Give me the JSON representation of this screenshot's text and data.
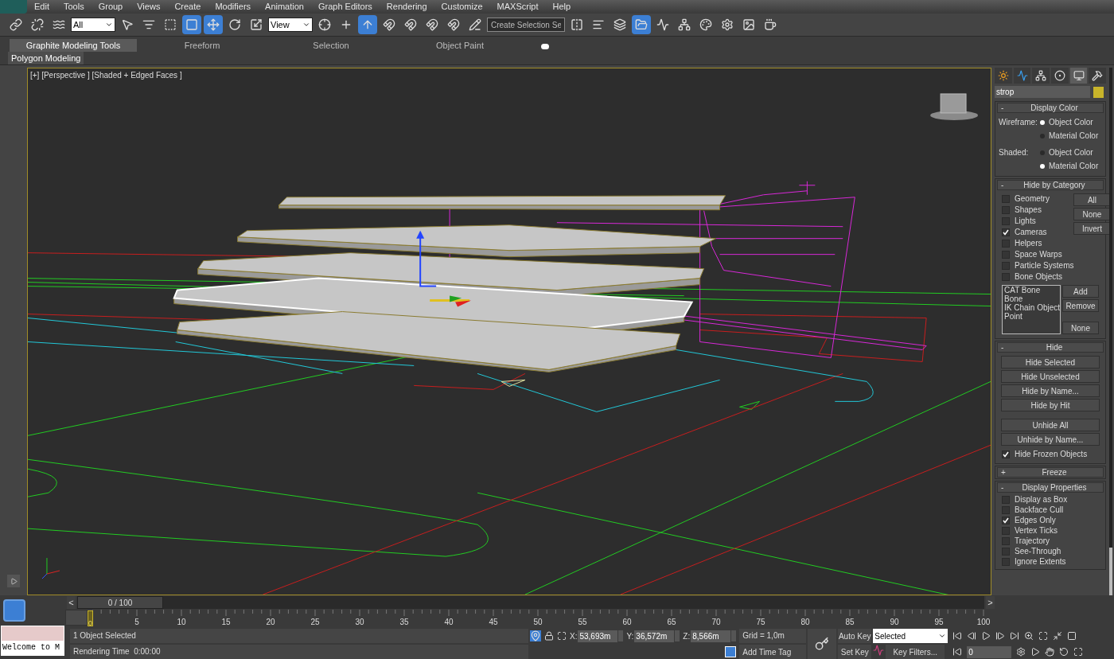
{
  "menu": [
    "Edit",
    "Tools",
    "Group",
    "Views",
    "Create",
    "Modifiers",
    "Animation",
    "Graph Editors",
    "Rendering",
    "Customize",
    "MAXScript",
    "Help"
  ],
  "toolbar": [
    {
      "kind": "icon",
      "selected": false
    },
    {
      "kind": "icon",
      "selected": false
    },
    {
      "kind": "icon",
      "selected": false
    },
    {
      "kind": "dropdown",
      "value": "All"
    },
    {
      "kind": "icon",
      "selected": false
    },
    {
      "kind": "icon",
      "selected": false
    },
    {
      "kind": "icon",
      "selected": false
    },
    {
      "kind": "icon",
      "selected": true
    },
    {
      "kind": "icon",
      "selected": true
    },
    {
      "kind": "icon",
      "selected": false
    },
    {
      "kind": "icon",
      "selected": false
    },
    {
      "kind": "dropdown",
      "value": "View"
    },
    {
      "kind": "icon",
      "selected": false
    },
    {
      "kind": "icon",
      "selected": false
    },
    {
      "kind": "icon",
      "selected": true
    },
    {
      "kind": "icon",
      "selected": false
    },
    {
      "kind": "icon",
      "selected": false
    },
    {
      "kind": "icon",
      "selected": false
    },
    {
      "kind": "icon",
      "selected": false
    },
    {
      "kind": "icon",
      "selected": false
    },
    {
      "kind": "field",
      "placeholder": "Create Selection Se"
    },
    {
      "kind": "icon",
      "selected": false
    },
    {
      "kind": "icon",
      "selected": false
    },
    {
      "kind": "icon",
      "selected": false
    },
    {
      "kind": "icon",
      "selected": true
    },
    {
      "kind": "icon",
      "selected": false
    },
    {
      "kind": "icon",
      "selected": false
    },
    {
      "kind": "icon",
      "selected": false
    },
    {
      "kind": "icon",
      "selected": false
    },
    {
      "kind": "icon",
      "selected": false
    },
    {
      "kind": "icon",
      "selected": false
    }
  ],
  "ribbon": {
    "tabs": [
      {
        "label": "Graphite Modeling Tools",
        "selected": true
      },
      {
        "label": "Freeform",
        "selected": false
      },
      {
        "label": "Selection",
        "selected": false
      },
      {
        "label": "Object Paint",
        "selected": false
      }
    ],
    "panel": "Polygon Modeling"
  },
  "viewport": {
    "label": "[+] [Perspective ] [Shaded + Edged Faces ]"
  },
  "command_panel": {
    "tabs": [
      {
        "selected": false
      },
      {
        "selected": false
      },
      {
        "selected": false
      },
      {
        "selected": false
      },
      {
        "selected": true
      },
      {
        "selected": false
      }
    ],
    "object_name": "strop",
    "rollouts": [
      {
        "kind": "display_color",
        "sign": "-",
        "title": "Display Color",
        "groups": [
          {
            "label": "Wireframe:",
            "options": [
              {
                "label": "Object Color",
                "selected": true
              },
              {
                "label": "Material Color",
                "selected": false
              }
            ]
          },
          {
            "label": "Shaded:",
            "options": [
              {
                "label": "Object Color",
                "selected": false
              },
              {
                "label": "Material Color",
                "selected": true
              }
            ]
          }
        ]
      },
      {
        "kind": "hide_by_category",
        "sign": "-",
        "title": "Hide by Category",
        "checks": [
          {
            "label": "Geometry",
            "checked": false
          },
          {
            "label": "Shapes",
            "checked": false
          },
          {
            "label": "Lights",
            "checked": false
          },
          {
            "label": "Cameras",
            "checked": true
          },
          {
            "label": "Helpers",
            "checked": false
          },
          {
            "label": "Space Warps",
            "checked": false
          },
          {
            "label": "Particle Systems",
            "checked": false
          },
          {
            "label": "Bone Objects",
            "checked": false
          }
        ],
        "buttons": [
          "All",
          "None",
          "Invert"
        ],
        "list": [
          "CAT Bone",
          "Bone",
          "IK Chain Object",
          "Point"
        ],
        "list_buttons": [
          "Add",
          "Remove",
          "None"
        ]
      },
      {
        "kind": "hide",
        "sign": "-",
        "title": "Hide",
        "buttons": [
          "Hide Selected",
          "Hide Unselected",
          "Hide by Name...",
          "Hide by Hit"
        ],
        "buttons2": [
          "Unhide All",
          "Unhide by Name..."
        ],
        "check": {
          "label": "Hide Frozen Objects",
          "checked": true
        }
      },
      {
        "kind": "collapsed",
        "sign": "+",
        "title": "Freeze"
      },
      {
        "kind": "checks",
        "sign": "-",
        "title": "Display Properties",
        "checks": [
          {
            "label": "Display as Box",
            "checked": false
          },
          {
            "label": "Backface Cull",
            "checked": false
          },
          {
            "label": "Edges Only",
            "checked": true
          },
          {
            "label": "Vertex Ticks",
            "checked": false
          },
          {
            "label": "Trajectory",
            "checked": false
          },
          {
            "label": "See-Through",
            "checked": false
          },
          {
            "label": "Ignore Extents",
            "checked": false
          }
        ]
      }
    ]
  },
  "time_slider": {
    "prev": "<",
    "next": ">",
    "position": "0 / 100",
    "level": 0
  },
  "track_bar": {
    "current": "0",
    "labels": [
      "5",
      "10",
      "15",
      "20",
      "25",
      "30",
      "35",
      "40",
      "45",
      "50",
      "55",
      "60",
      "65",
      "70",
      "75",
      "80",
      "85",
      "90",
      "95",
      "100"
    ]
  },
  "listener": {
    "output": "Welcome to M"
  },
  "status": {
    "selection": "1 Object Selected",
    "prompt": "Rendering Time  0:00:00",
    "x_label": "X:",
    "x": "53,693m",
    "y_label": "Y:",
    "y": "36,572m",
    "z_label": "Z:",
    "z": "8,566m",
    "grid": "Grid = 1,0m",
    "time_tag": "Add Time Tag"
  },
  "keys": {
    "auto_key": "Auto Key",
    "set_key": "Set Key",
    "key_mode": "Selected",
    "key_filters": "Key Filters...",
    "frame": "0"
  }
}
